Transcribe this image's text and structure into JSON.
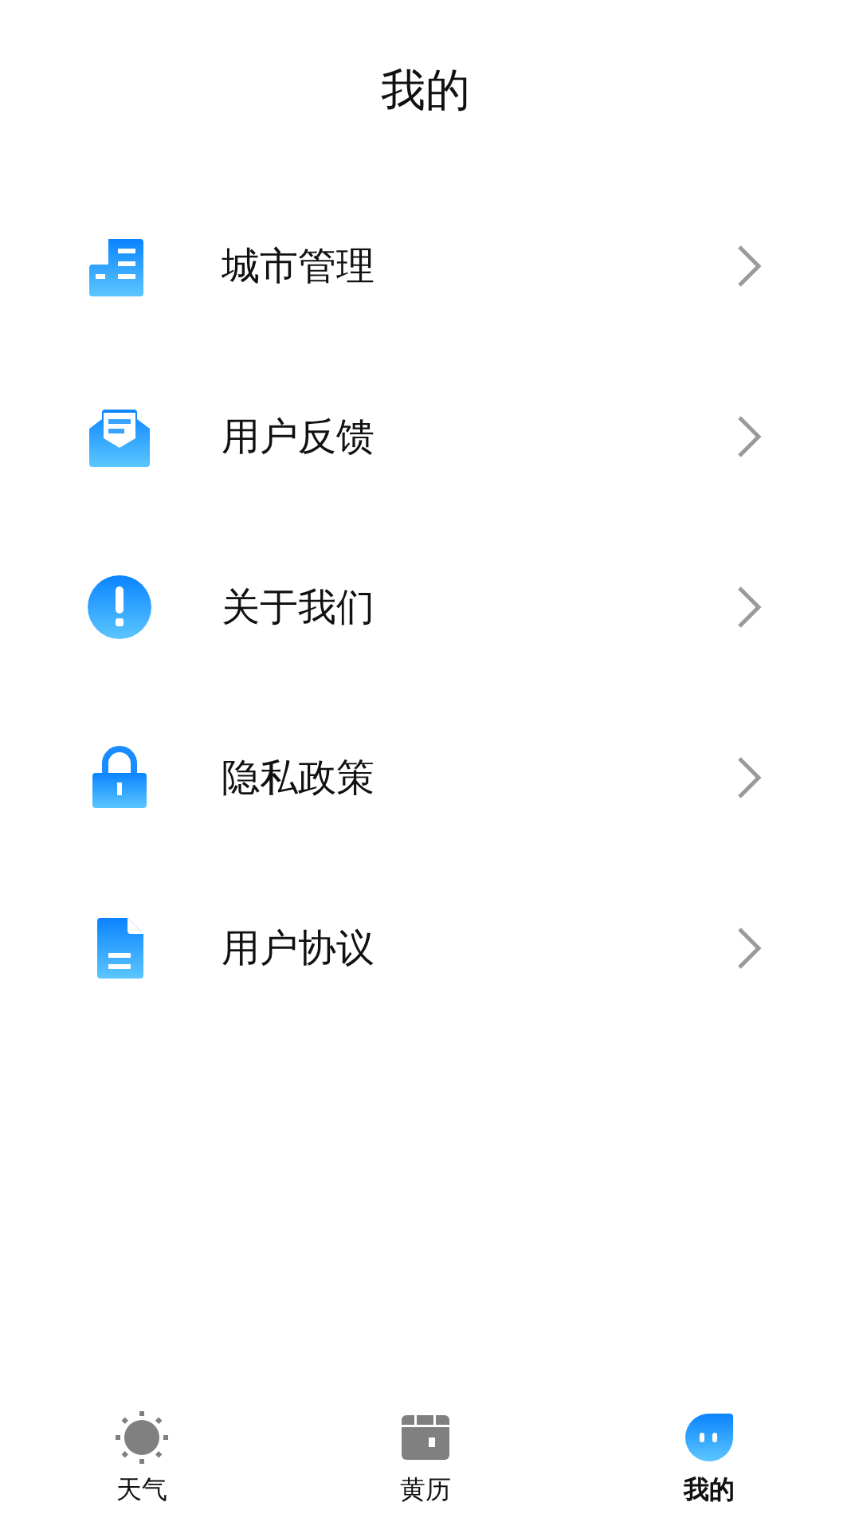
{
  "title": "我的",
  "menu": [
    {
      "label": "城市管理",
      "kind": "city"
    },
    {
      "label": "用户反馈",
      "kind": "feedback"
    },
    {
      "label": "关于我们",
      "kind": "about"
    },
    {
      "label": "隐私政策",
      "kind": "privacy"
    },
    {
      "label": "用户协议",
      "kind": "agreement"
    }
  ],
  "tabs": [
    {
      "label": "天气",
      "kind": "weather",
      "selected": false
    },
    {
      "label": "黄历",
      "kind": "calendar",
      "selected": false
    },
    {
      "label": "我的",
      "kind": "mine",
      "selected": true
    }
  ]
}
